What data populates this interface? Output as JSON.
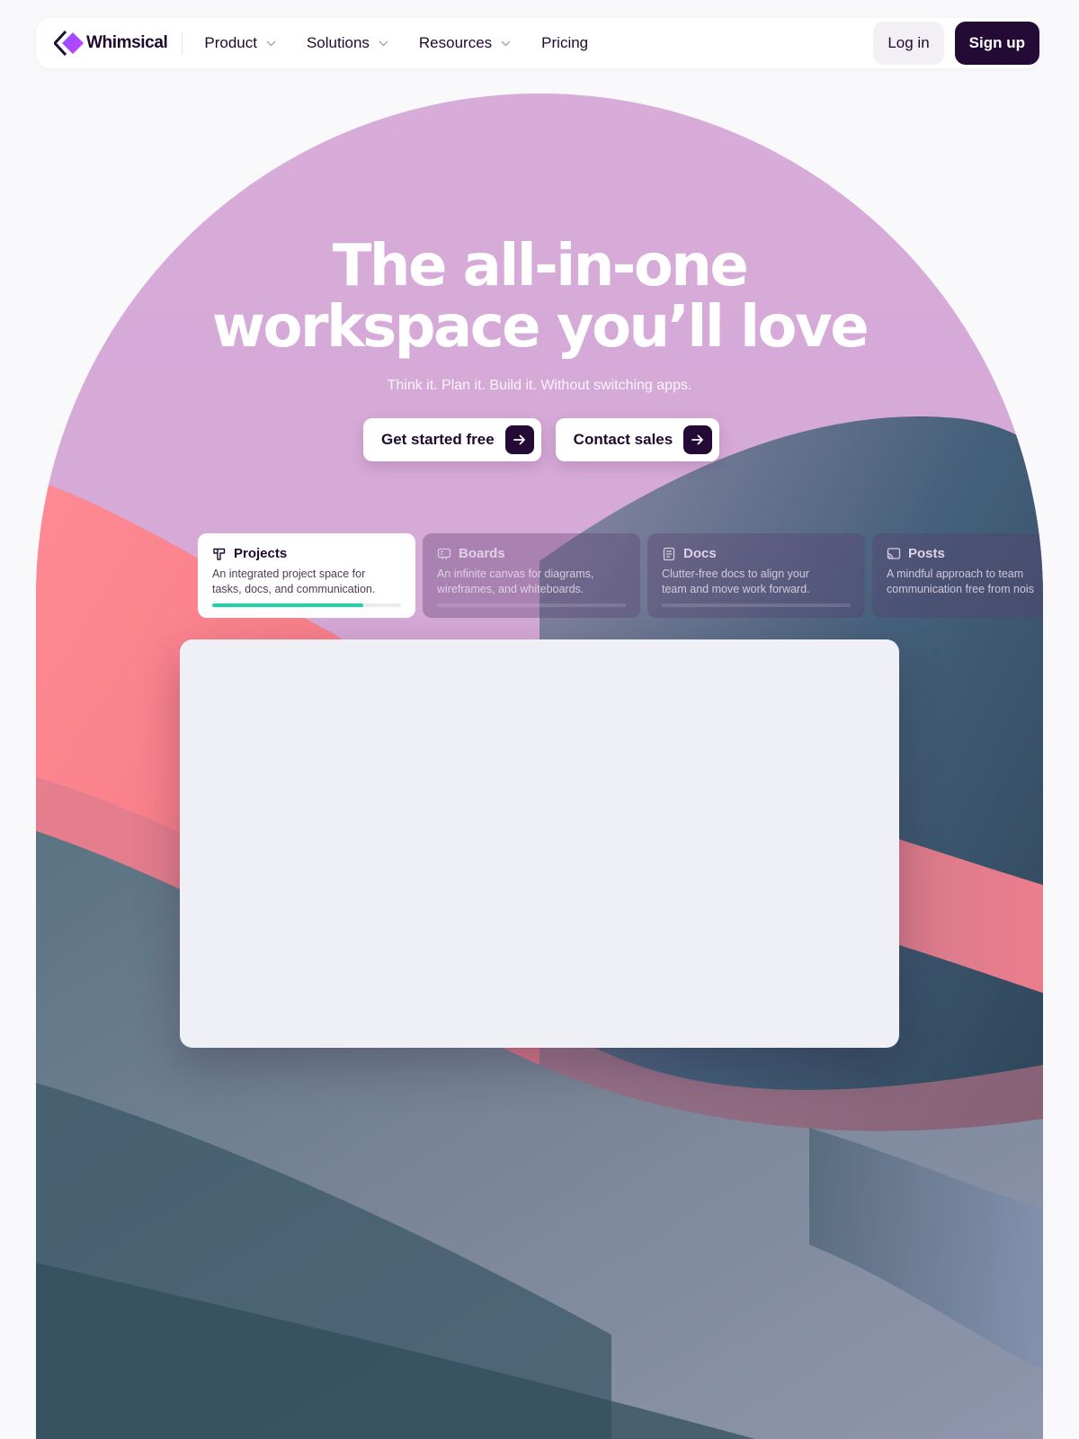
{
  "brand": {
    "name": "Whimsical"
  },
  "nav": {
    "links": [
      {
        "label": "Product",
        "has_dropdown": true
      },
      {
        "label": "Solutions",
        "has_dropdown": true
      },
      {
        "label": "Resources",
        "has_dropdown": true
      },
      {
        "label": "Pricing",
        "has_dropdown": false
      }
    ],
    "login_label": "Log in",
    "signup_label": "Sign up"
  },
  "hero": {
    "title_line1": "The all-in-one",
    "title_line2": "workspace you’ll love",
    "subtitle": "Think it. Plan it. Build it. Without switching apps.",
    "cta_primary": "Get started free",
    "cta_secondary": "Contact sales"
  },
  "tabs": [
    {
      "title": "Projects",
      "icon": "projects-icon",
      "desc_line1": "An integrated project space for",
      "desc_line2": "tasks, docs, and communication.",
      "progress": 0.8,
      "active": true
    },
    {
      "title": "Boards",
      "icon": "boards-icon",
      "desc_line1": "An infinite canvas for diagrams,",
      "desc_line2": "wireframes, and whiteboards.",
      "progress": 0,
      "active": false
    },
    {
      "title": "Docs",
      "icon": "docs-icon",
      "desc_line1": "Clutter-free docs to align your",
      "desc_line2": "team and move work forward.",
      "progress": 0,
      "active": false
    },
    {
      "title": "Posts",
      "icon": "posts-icon",
      "desc_line1": "A mindful approach to team",
      "desc_line2": "communication free from noise",
      "progress": 0,
      "active": false
    }
  ],
  "colors": {
    "brand_dark": "#240b36",
    "hero_lilac": "#d6abd9",
    "progress_green": "#1ed3a6",
    "wave_coral": "#ff7a86",
    "wave_slate": "#3e5565"
  }
}
